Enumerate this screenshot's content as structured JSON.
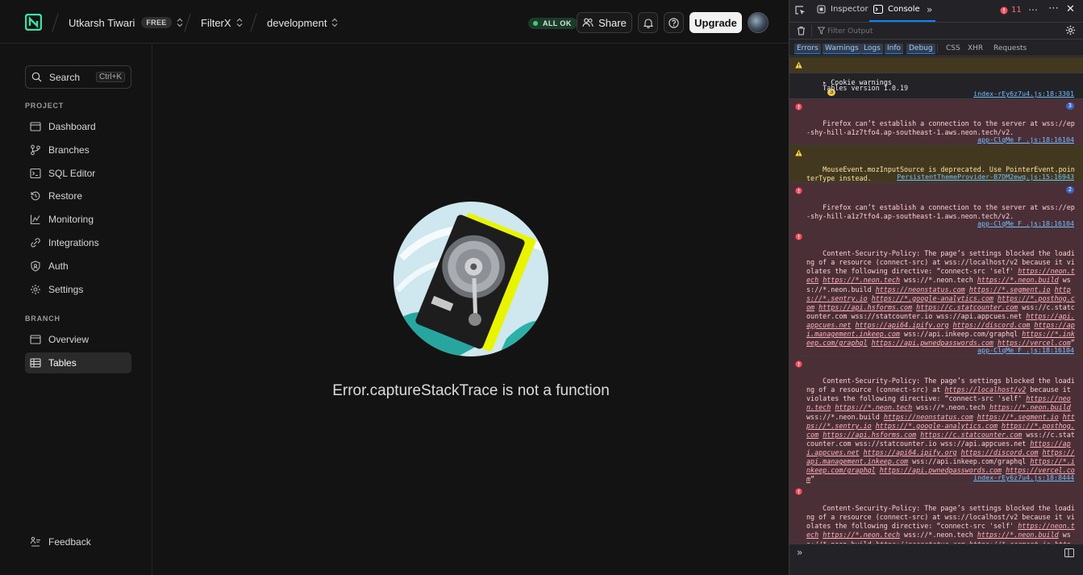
{
  "header": {
    "user_name": "Utkarsh Tiwari",
    "plan_badge": "FREE",
    "project": "FilterX",
    "branch": "development",
    "status": "ALL OK",
    "share_label": "Share",
    "upgrade_label": "Upgrade"
  },
  "sidebar": {
    "search_label": "Search",
    "search_shortcut": "Ctrl+K",
    "project_section": "PROJECT",
    "project_items": [
      {
        "label": "Dashboard",
        "icon": "dashboard-icon"
      },
      {
        "label": "Branches",
        "icon": "branches-icon"
      },
      {
        "label": "SQL Editor",
        "icon": "sql-editor-icon"
      },
      {
        "label": "Restore",
        "icon": "restore-icon"
      },
      {
        "label": "Monitoring",
        "icon": "monitoring-icon"
      },
      {
        "label": "Integrations",
        "icon": "integrations-icon"
      },
      {
        "label": "Auth",
        "icon": "auth-icon"
      },
      {
        "label": "Settings",
        "icon": "settings-icon"
      }
    ],
    "branch_section": "BRANCH",
    "branch_items": [
      {
        "label": "Overview",
        "icon": "overview-icon"
      },
      {
        "label": "Tables",
        "icon": "tables-icon",
        "active": true
      }
    ],
    "feedback_label": "Feedback"
  },
  "main": {
    "error_message": "Error.captureStackTrace is not a function"
  },
  "devtools": {
    "tabs": {
      "inspector": "Inspector",
      "console": "Console"
    },
    "error_count": "11",
    "filter_placeholder": "Filter Output",
    "categories": {
      "errors": "Errors",
      "warnings": "Warnings",
      "logs": "Logs",
      "info": "Info",
      "debug": "Debug",
      "css": "CSS",
      "xhr": "XHR",
      "requests": "Requests"
    },
    "cookie_group": {
      "label": "Cookie warnings",
      "count": "3"
    },
    "messages": [
      {
        "type": "log",
        "text": "Tables version 1.0.19",
        "source": "index-rEy6z7u4.js:18:3301"
      },
      {
        "type": "error",
        "text": "Firefox can’t establish a connection to the server at wss://ep-shy-hill-a1z7tfo4.ap-southeast-1.aws.neon.tech/v2.",
        "source": "app-ClqMe_F_.js:18:16104",
        "repeat": "3"
      },
      {
        "type": "warn",
        "text": "MouseEvent.mozInputSource is deprecated. Use PointerEvent.pointerType instead.",
        "source": "PersistentThemeProvider-B7DM2ewq.js:15:16943"
      },
      {
        "type": "error",
        "text": "Firefox can’t establish a connection to the server at wss://ep-shy-hill-a1z7tfo4.ap-southeast-1.aws.neon.tech/v2.",
        "source": "app-ClqMe_F_.js:18:16104",
        "repeat": "2"
      }
    ],
    "csp_prefix_1": "Content-Security-Policy: The page’s settings blocked the loading of a resource (connect-src) at wss://localhost/v2 because it violates the following directive: “connect-src 'self'",
    "csp_prefix_2": "Content-Security-Policy: The page’s settings blocked the loading of a resource (connect-src) at",
    "csp_prefix_2b": "because it violates the following directive: “connect-src 'self'",
    "csp_localhost_link": "https://localhost/v2",
    "csp_sources": [
      {
        "t": "https://neon.tech",
        "l": true
      },
      {
        "t": "https://*.neon.tech",
        "l": true
      },
      {
        "t": "wss://*.neon.tech",
        "l": false
      },
      {
        "t": "https://*.neon.build",
        "l": true
      },
      {
        "t": "wss://*.neon.build",
        "l": false
      },
      {
        "t": "https://neonstatus.com",
        "l": true
      },
      {
        "t": "https://*.segment.io",
        "l": true
      },
      {
        "t": "https://*.sentry.io",
        "l": true
      },
      {
        "t": "https://*.google-analytics.com",
        "l": true
      },
      {
        "t": "https://*.posthog.com",
        "l": true
      },
      {
        "t": "https://api.hsforms.com",
        "l": true
      },
      {
        "t": "https://c.statcounter.com",
        "l": true
      },
      {
        "t": "wss://c.statcounter.com",
        "l": false
      },
      {
        "t": "wss://statcounter.io",
        "l": false
      },
      {
        "t": "wss://api.appcues.net",
        "l": false
      },
      {
        "t": "https://api.appcues.net",
        "l": true
      },
      {
        "t": "https://api64.ipify.org",
        "l": true
      },
      {
        "t": "https://discord.com",
        "l": true
      },
      {
        "t": "https://api.management.inkeep.com",
        "l": true
      },
      {
        "t": "wss://api.inkeep.com/graphql",
        "l": false
      },
      {
        "t": "https://*.inkeep.com/graphql",
        "l": true
      },
      {
        "t": "https://api.pwnedpasswords.com",
        "l": true
      },
      {
        "t": "https://vercel.com",
        "l": true
      }
    ],
    "csp_sources_1": "app-ClqMe_F_.js:18:16104",
    "csp_sources_2": "index-rEy6z7u4.js:18:8444",
    "csp_partial": "Content-Security-Policy: The page’s settings blocked the loading of a resource (connect-src) at wss://localhost/v2 because it violates the following directive: “connect-src 'self'"
  },
  "colors": {
    "accent": "#0a84ff",
    "error_bg": "#4b2f36",
    "warn_bg": "#42381f",
    "ok": "#3ecf6d"
  }
}
